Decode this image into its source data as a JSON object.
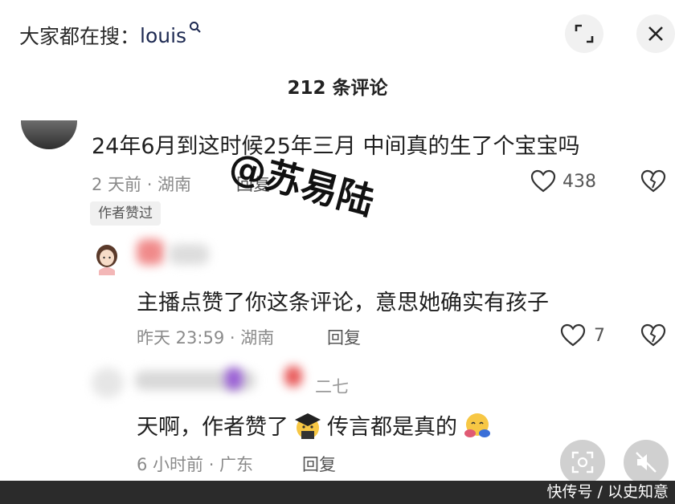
{
  "search": {
    "prefix": "大家都在搜：",
    "keyword": "louis",
    "icon": "search-icon"
  },
  "header": {
    "comment_count_label": "212 条评论"
  },
  "comments": [
    {
      "text": "24年6月到这时候25年三月  中间真的生了个宝宝吗",
      "time_location": "2 天前 · 湖南",
      "reply_label": "回复",
      "likes": "438",
      "badge": "作者赞过"
    },
    {
      "text": "主播点赞了你这条评论，意思她确实有孩子",
      "time_location": "昨天 23:59 · 湖南",
      "reply_label": "回复",
      "likes": "7"
    },
    {
      "name_fragment": "二七",
      "text_part1": "天啊，作者赞了",
      "text_part2": "传言都是真的",
      "time_location": "6 小时前 · 广东",
      "reply_label": "回复"
    }
  ],
  "watermark": "@苏易陆",
  "footer": {
    "credit": "快传号 / 以史知意"
  },
  "colors": {
    "accent_keyword": "#1e2a52",
    "meta_gray": "#8a8a8a",
    "footer_bg": "#2b2b2b"
  }
}
